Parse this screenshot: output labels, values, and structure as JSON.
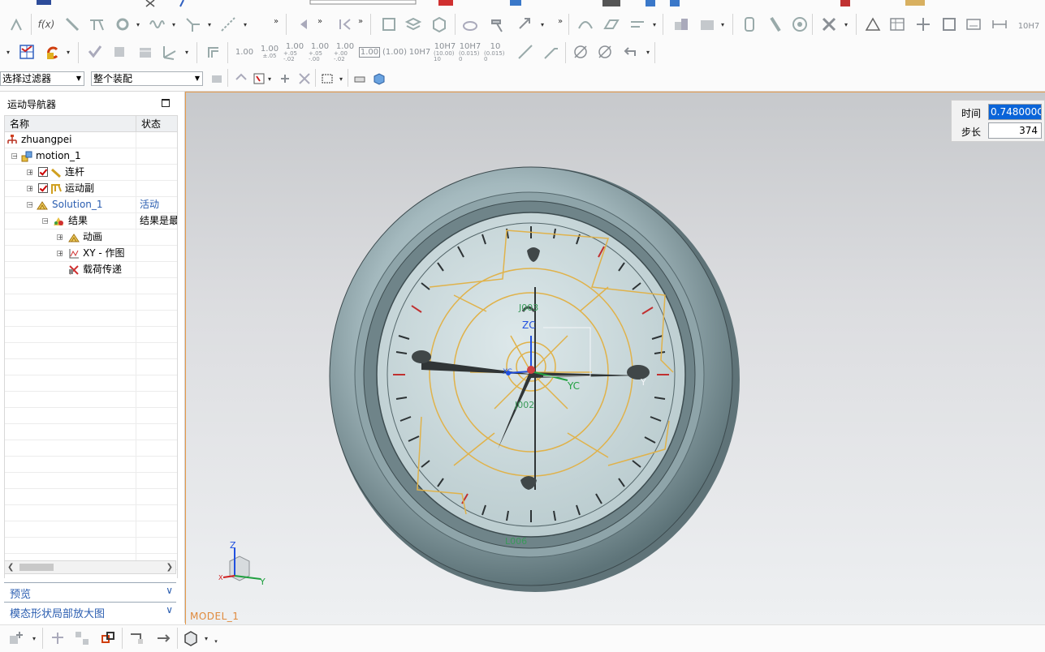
{
  "toolbar": {
    "tolerance_buttons": [
      {
        "top": "1.00",
        "bottom": ""
      },
      {
        "top": "1.00",
        "bottom": "±.05"
      },
      {
        "top": "1.00",
        "bottom": "+.05 -.02"
      },
      {
        "top": "1.00",
        "bottom": "+.05 -.00"
      },
      {
        "top": "1.00",
        "bottom": "+.00 -.02"
      },
      {
        "top": "1.00",
        "bottom": ""
      },
      {
        "top": "(1.00)",
        "bottom": ""
      },
      {
        "top": "10H7",
        "bottom": ""
      },
      {
        "top": "10H7",
        "bottom": "(10.00) 10"
      },
      {
        "top": "10H7",
        "bottom": "(0.015) 0"
      },
      {
        "top": "10",
        "bottom": "(0.015) 0"
      }
    ],
    "fx_label": "f(x)",
    "far_right_label": "10H7"
  },
  "filterbar": {
    "select_filter": "选择过滤器",
    "scope_select": "整个装配"
  },
  "navigator": {
    "title": "运动导航器",
    "col_name": "名称",
    "col_state": "状态",
    "rows": [
      {
        "name": "zhuangpei",
        "state": ""
      },
      {
        "name": "motion_1",
        "state": ""
      },
      {
        "name": "连杆",
        "state": ""
      },
      {
        "name": "运动副",
        "state": ""
      },
      {
        "name": "Solution_1",
        "state": "活动"
      },
      {
        "name": "结果",
        "state": "结果是最"
      },
      {
        "name": "动画",
        "state": ""
      },
      {
        "name": "XY - 作图",
        "state": ""
      },
      {
        "name": "载荷传递",
        "state": ""
      }
    ],
    "preview_label": "预览",
    "zoom_label": "模态形状局部放大图"
  },
  "viewport": {
    "model_label": "MODEL_1",
    "time_label": "时间",
    "time_value": "0.748000C",
    "step_label": "步长",
    "step_value": "374",
    "csys": {
      "zc": "ZC",
      "yc": "YC",
      "xc": "XC"
    },
    "mini_csys": {
      "z": "Z",
      "y": "Y",
      "x": "X"
    },
    "annotations": {
      "j003": "J003",
      "j002": "J002",
      "l006": "L006",
      "y": "Y"
    }
  },
  "colors": {
    "accent_orange": "#e08a3c",
    "link_blue": "#2a5db0",
    "mechanism_gold": "#e0b24a",
    "clock_body": "#a9bfc4"
  }
}
